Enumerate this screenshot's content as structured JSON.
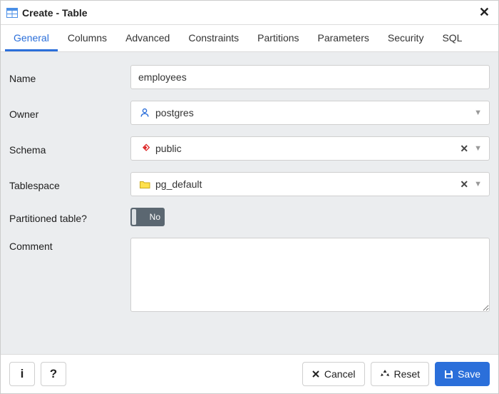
{
  "dialog": {
    "title": "Create - Table"
  },
  "tabs": [
    {
      "label": "General",
      "active": true
    },
    {
      "label": "Columns"
    },
    {
      "label": "Advanced"
    },
    {
      "label": "Constraints"
    },
    {
      "label": "Partitions"
    },
    {
      "label": "Parameters"
    },
    {
      "label": "Security"
    },
    {
      "label": "SQL"
    }
  ],
  "fields": {
    "name": {
      "label": "Name",
      "value": "employees"
    },
    "owner": {
      "label": "Owner",
      "value": "postgres",
      "icon": "user-icon"
    },
    "schema": {
      "label": "Schema",
      "value": "public",
      "icon": "schema-icon",
      "clearable": true
    },
    "tablespace": {
      "label": "Tablespace",
      "value": "pg_default",
      "icon": "folder-icon",
      "clearable": true
    },
    "partitioned": {
      "label": "Partitioned table?",
      "state_label": "No",
      "value": false
    },
    "comment": {
      "label": "Comment",
      "value": ""
    }
  },
  "footer": {
    "info": "i",
    "help": "?",
    "cancel": "Cancel",
    "reset": "Reset",
    "save": "Save"
  }
}
